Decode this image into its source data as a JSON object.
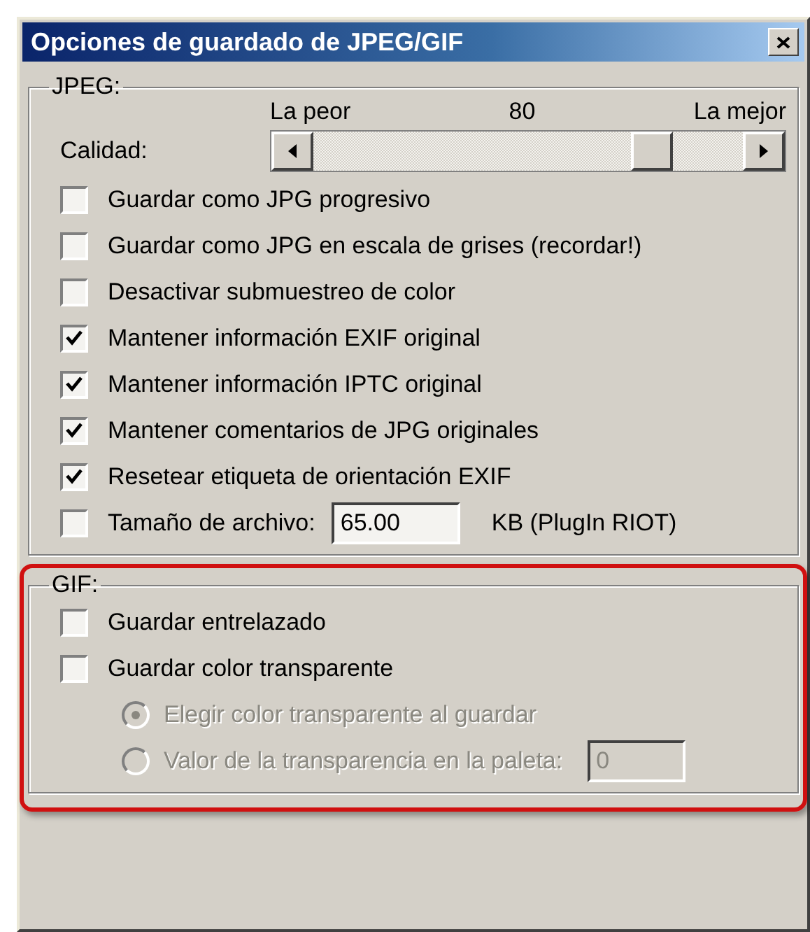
{
  "window": {
    "title": "Opciones de guardado de JPEG/GIF"
  },
  "jpeg": {
    "legend": "JPEG:",
    "quality": {
      "label": "Calidad:",
      "min_label": "La peor",
      "value": "80",
      "max_label": "La mejor",
      "level": 0.82
    },
    "options": [
      {
        "label": "Guardar como JPG progresivo",
        "checked": false
      },
      {
        "label": "Guardar como JPG en escala de grises (recordar!)",
        "checked": false
      },
      {
        "label": "Desactivar submuestreo de color",
        "checked": false
      },
      {
        "label": "Mantener información EXIF original",
        "checked": true
      },
      {
        "label": "Mantener información IPTC original",
        "checked": true
      },
      {
        "label": "Mantener comentarios de JPG originales",
        "checked": true
      },
      {
        "label": "Resetear etiqueta de orientación EXIF",
        "checked": true
      }
    ],
    "file_size": {
      "label": "Tamaño de archivo:",
      "checked": false,
      "value": "65.00",
      "unit": "KB (PlugIn RIOT)"
    }
  },
  "gif": {
    "legend": "GIF:",
    "highlighted": true,
    "options": [
      {
        "label": "Guardar entrelazado",
        "checked": false
      },
      {
        "label": "Guardar color transparente",
        "checked": false
      }
    ],
    "transparency": [
      {
        "label": "Elegir color transparente al guardar",
        "selected": true,
        "disabled": true
      },
      {
        "label": "Valor de la transparencia en la paleta:",
        "selected": false,
        "disabled": true
      }
    ],
    "palette_field": {
      "value": "0",
      "disabled": true
    }
  }
}
